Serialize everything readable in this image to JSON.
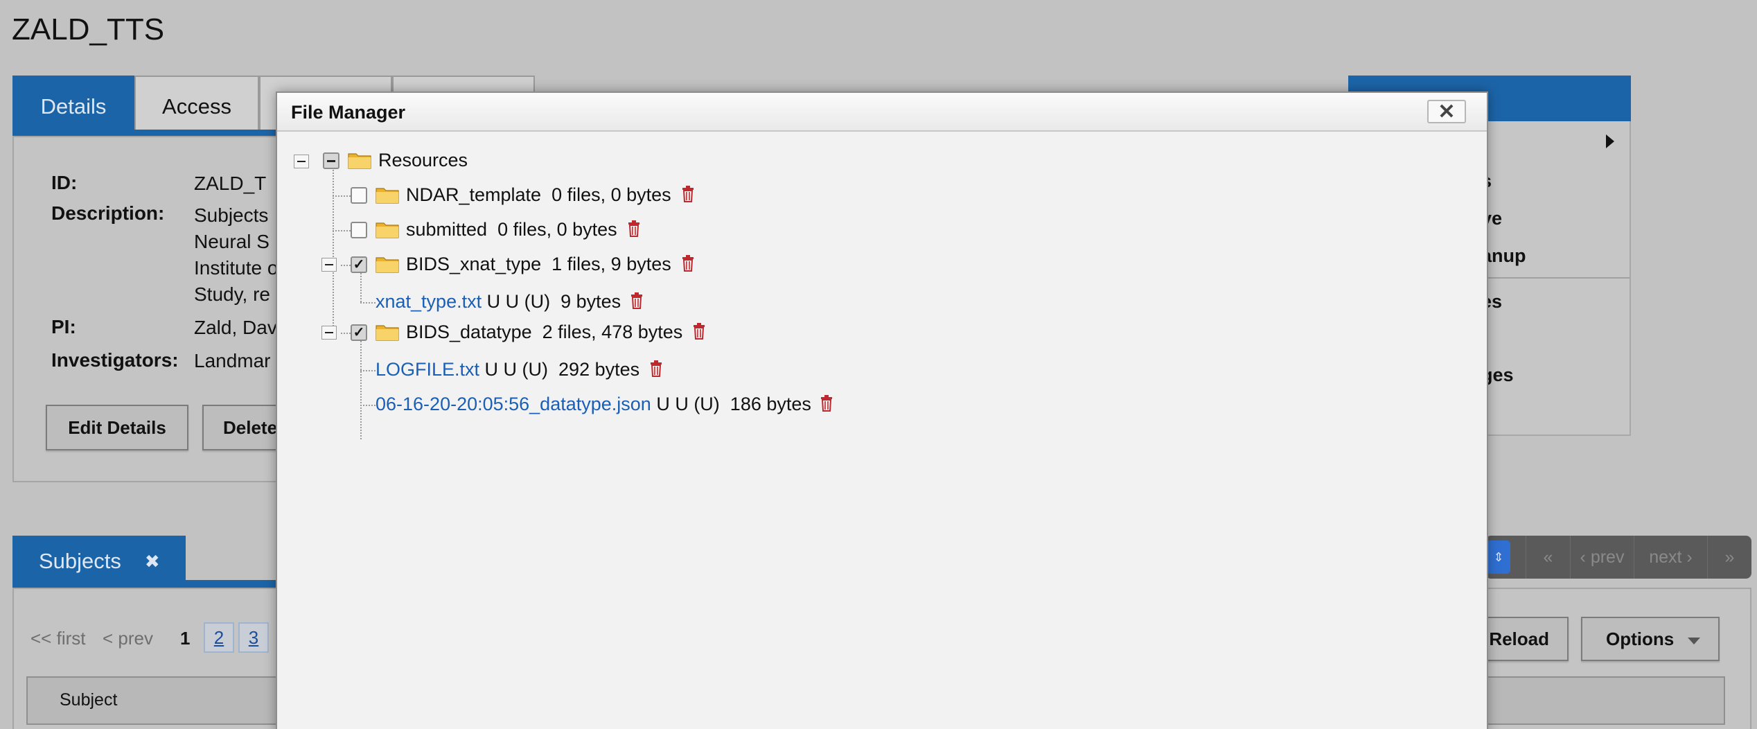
{
  "page": {
    "title": "ZALD_TTS"
  },
  "details": {
    "tabs": [
      "Details",
      "Access",
      "",
      ""
    ],
    "id_label": "ID:",
    "id_value": "ZALD_T",
    "description_label": "Description:",
    "description_lines": [
      "Subjects",
      "Neural S",
      "Institute o",
      "Study, re"
    ],
    "pi_label": "PI:",
    "pi_value": "Zald, Dav",
    "investigators_label": "Investigators:",
    "investigators_value": "Landmar",
    "edit_button": "Edit Details",
    "delete_button": "Delete"
  },
  "actions": {
    "items": [
      "s",
      "ve",
      "anup",
      "es",
      "-",
      "ges"
    ]
  },
  "subjects": {
    "tab_label": "Subjects",
    "tab_close": "✖",
    "first": "<< first",
    "prev": "< prev",
    "current_page": "1",
    "pages": [
      "2",
      "3"
    ],
    "reload_button": "Reload",
    "options_button": "Options",
    "column_subject": "Subject",
    "pager": {
      "first": "«",
      "prev": "‹ prev",
      "next": "next ›",
      "last": "»"
    }
  },
  "file_manager": {
    "title": "File Manager",
    "close": "✕",
    "root": {
      "name": "Resources"
    },
    "resources": [
      {
        "name": "NDAR_template",
        "info": "0 files, 0 bytes",
        "checked": false
      },
      {
        "name": "submitted",
        "info": "0 files, 0 bytes",
        "checked": false
      },
      {
        "name": "BIDS_xnat_type",
        "info": "1 files, 9 bytes",
        "checked": true,
        "files": [
          {
            "name": "xnat_type.txt",
            "meta": " U U (U)  9 bytes"
          }
        ]
      },
      {
        "name": "BIDS_datatype",
        "info": "2 files, 478 bytes",
        "checked": true,
        "files": [
          {
            "name": "LOGFILE.txt",
            "meta": " U U (U)  292 bytes"
          },
          {
            "name": "06-16-20-20:05:56_datatype.json",
            "meta": " U U (U)  186 bytes"
          }
        ]
      }
    ]
  },
  "colors": {
    "accent": "#1c64a8",
    "link": "#1a5fb4",
    "trash": "#c0282d",
    "background": "#c2c2c2"
  },
  "icons": {
    "folder": "folder-icon",
    "trash": "trash-icon",
    "close": "close-icon",
    "expander": "collapse-icon"
  }
}
